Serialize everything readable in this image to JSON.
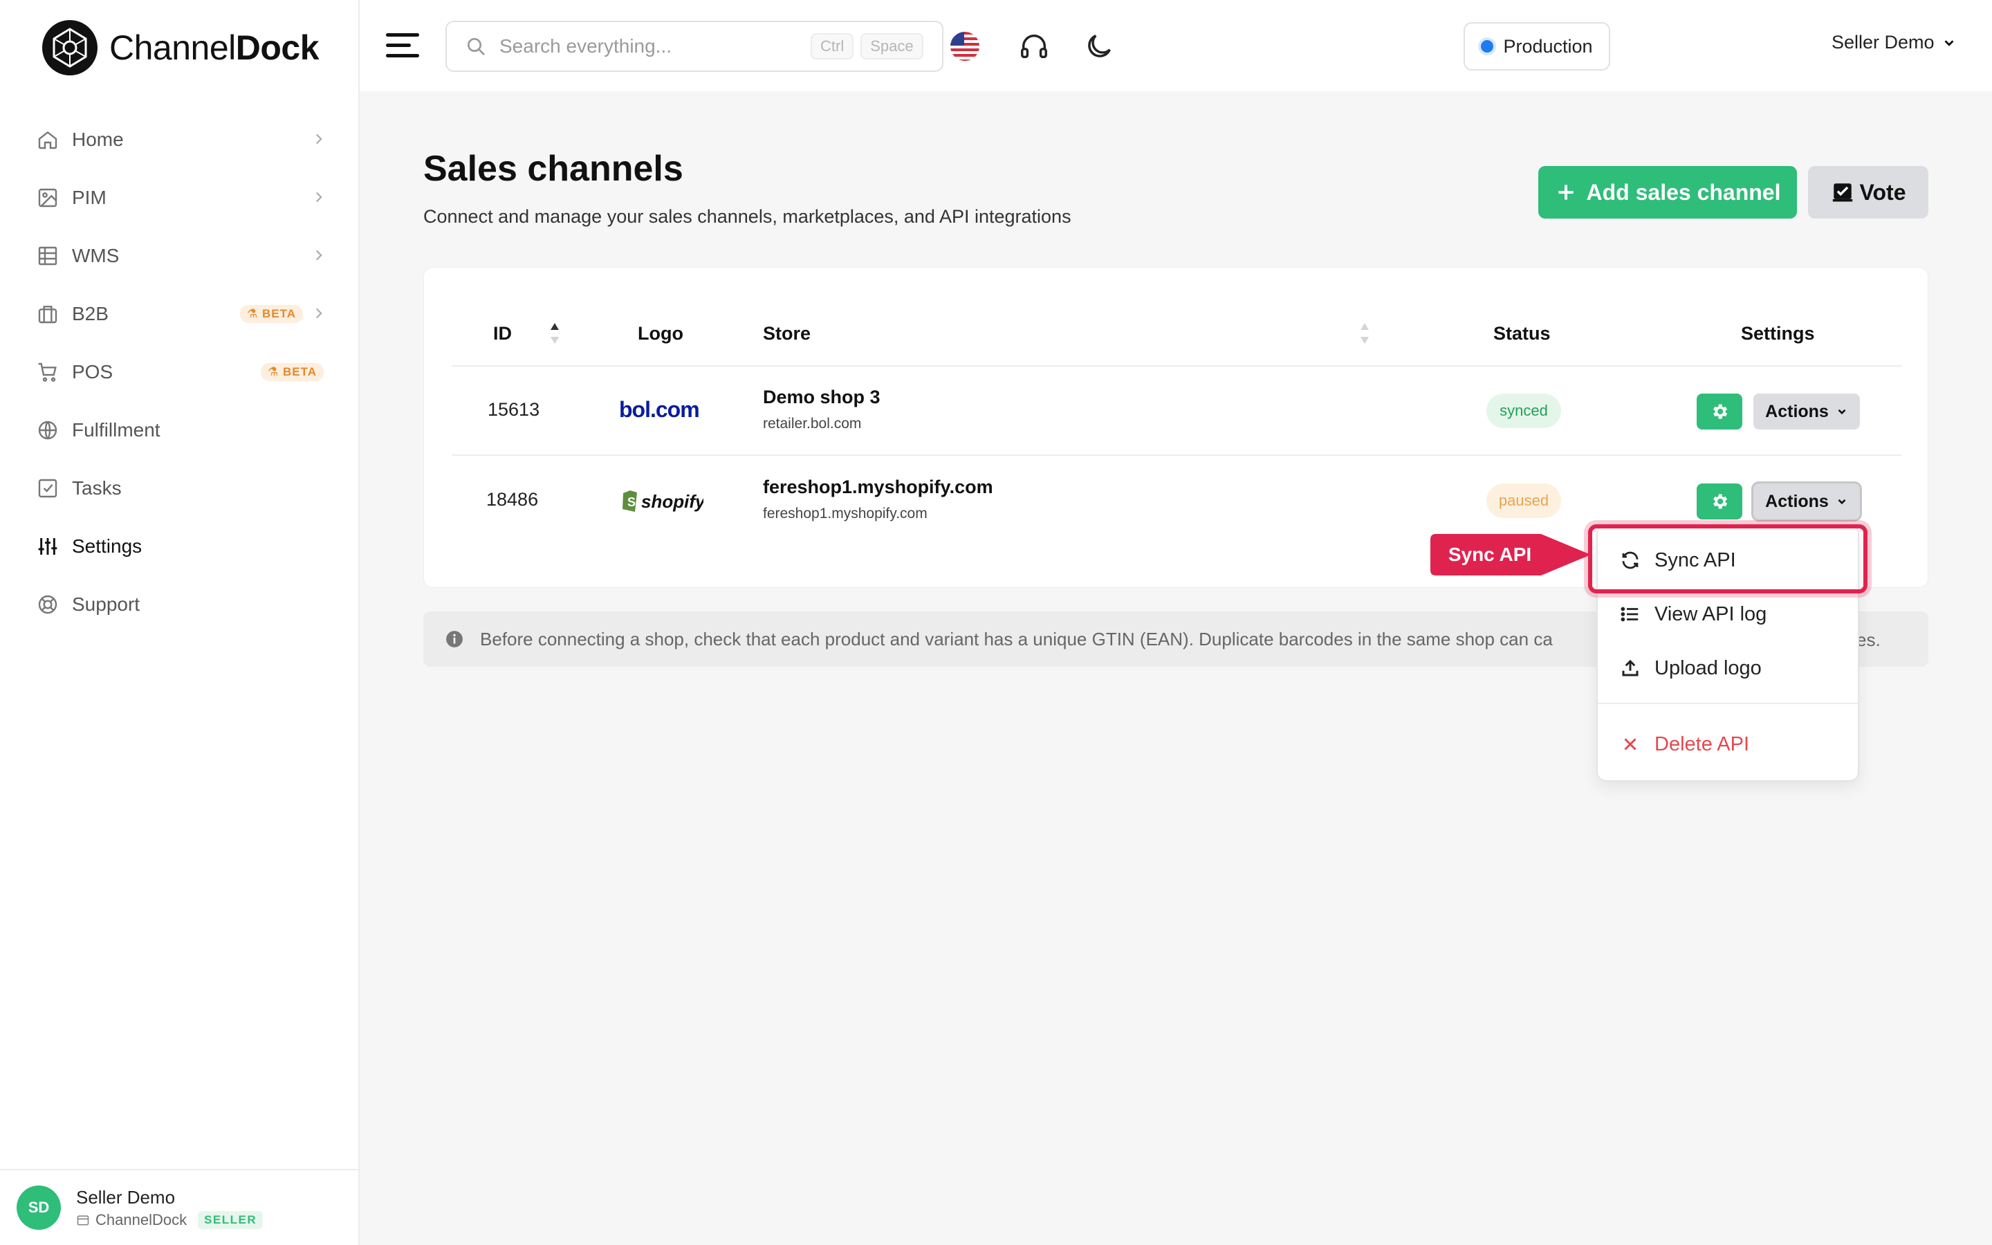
{
  "app": {
    "brand_light": "Channel",
    "brand_bold": "Dock"
  },
  "sidebar": {
    "items": [
      {
        "label": "Home",
        "icon": "home-icon",
        "chevron": true
      },
      {
        "label": "PIM",
        "icon": "image-icon",
        "chevron": true
      },
      {
        "label": "WMS",
        "icon": "grid-icon",
        "chevron": true
      },
      {
        "label": "B2B",
        "icon": "briefcase-icon",
        "chevron": true,
        "badge": "BETA"
      },
      {
        "label": "POS",
        "icon": "cart-icon",
        "chevron": false,
        "badge": "BETA"
      },
      {
        "label": "Fulfillment",
        "icon": "globe-icon",
        "chevron": false
      },
      {
        "label": "Tasks",
        "icon": "checkbox-icon",
        "chevron": false
      },
      {
        "label": "Settings",
        "icon": "sliders-icon",
        "chevron": false,
        "active": true
      },
      {
        "label": "Support",
        "icon": "lifebuoy-icon",
        "chevron": false
      }
    ],
    "footer": {
      "initials": "SD",
      "name": "Seller Demo",
      "org": "ChannelDock",
      "role_badge": "SELLER"
    }
  },
  "header": {
    "search_placeholder": "Search everything...",
    "kbd_ctrl": "Ctrl",
    "kbd_space": "Space",
    "environment": "Production",
    "user_menu": "Seller Demo"
  },
  "page": {
    "title": "Sales channels",
    "subtitle": "Connect and manage your sales channels, marketplaces, and API integrations",
    "add_button": "Add sales channel",
    "vote_button": "Vote"
  },
  "table": {
    "headers": {
      "id": "ID",
      "logo": "Logo",
      "store": "Store",
      "status": "Status",
      "settings": "Settings"
    },
    "rows": [
      {
        "id": "15613",
        "logo": "bol.com",
        "store_name": "Demo shop 3",
        "store_url": "retailer.bol.com",
        "status": "synced",
        "actions": "Actions"
      },
      {
        "id": "18486",
        "logo": "shopify",
        "store_name": "fereshop1.myshopify.com",
        "store_url": "fereshop1.myshopify.com",
        "status": "paused",
        "actions": "Actions"
      }
    ]
  },
  "notice": {
    "text": "Before connecting a shop, check that each product and variant has a unique GTIN (EAN). Duplicate barcodes in the same shop can ca",
    "tail": "es."
  },
  "dropdown": {
    "items": [
      {
        "label": "Sync API",
        "icon": "refresh-icon"
      },
      {
        "label": "View API log",
        "icon": "list-icon"
      },
      {
        "label": "Upload logo",
        "icon": "upload-icon"
      },
      {
        "label": "Delete API",
        "icon": "x-icon",
        "danger": true
      }
    ]
  },
  "callout": {
    "label": "Sync API"
  },
  "colors": {
    "brand_green": "#2fbd7a",
    "highlight": "#e0224f",
    "env_dot": "#1e7bf0",
    "danger": "#e5484d"
  }
}
